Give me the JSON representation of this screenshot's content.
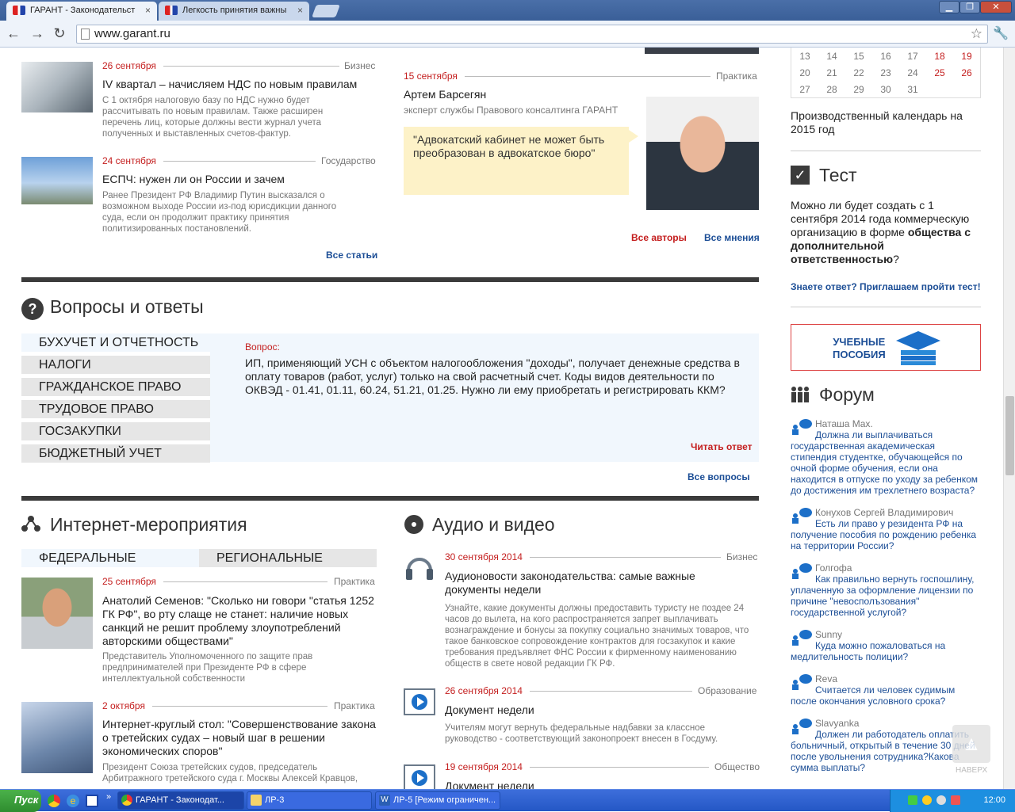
{
  "browser": {
    "tabs": [
      {
        "label": "ГАРАНТ - Законодательст",
        "close": "×"
      },
      {
        "label": "Легкость принятия важны",
        "close": "×"
      }
    ],
    "url": "www.garant.ru",
    "window_controls": [
      "▁",
      "❐",
      "✕"
    ]
  },
  "articles": [
    {
      "date": "26 сентября",
      "category": "Бизнес",
      "title": "IV квартал – начисляем НДС по новым правилам",
      "desc": "С 1 октября налоговую базу по НДС нужно будет рассчитывать по новым правилам. Также расширен перечень лиц, которые должны вести журнал учета полученных и выставленных счетов-фактур."
    },
    {
      "date": "24 сентября",
      "category": "Государство",
      "title": "ЕСПЧ: нужен ли он России и зачем",
      "desc": "Ранее Президент РФ Владимир Путин высказался о возможном выходе России из-под юрисдикции данного суда, если он продолжит практику принятия политизированных постановлений."
    }
  ],
  "all_articles": "Все статьи",
  "opinion": {
    "date": "15 сентября",
    "category": "Практика",
    "author": "Артем Барсегян",
    "role": "эксперт службы Правового консалтинга ГАРАНТ",
    "quote": "\"Адвокатский кабинет не может быть преобразован в адвокатское бюро\"",
    "all_authors": "Все авторы",
    "all_opinions": "Все мнения"
  },
  "qa": {
    "title": "Вопросы и ответы",
    "categories": [
      "БУХУЧЕТ И ОТЧЕТНОСТЬ",
      "НАЛОГИ",
      "ГРАЖДАНСКОЕ ПРАВО",
      "ТРУДОВОЕ ПРАВО",
      "ГОСЗАКУПКИ",
      "БЮДЖЕТНЫЙ УЧЕТ"
    ],
    "question_label": "Вопрос:",
    "question": "ИП, применяющий УСН с объектом налогообложения \"доходы\", получает денежные средства в оплату товаров (работ, услуг) только на свой расчетный счет. Коды видов деятельности по ОКВЭД - 01.41, 01.11, 60.24, 51.21, 01.25. Нужно ли ему приобретать и регистрировать ККМ?",
    "read_answer": "Читать ответ",
    "all_questions": "Все вопросы"
  },
  "events": {
    "title": "Интернет-мероприятия",
    "tabs": [
      "ФЕДЕРАЛЬНЫЕ",
      "РЕГИОНАЛЬНЫЕ"
    ],
    "items": [
      {
        "date": "25 сентября",
        "category": "Практика",
        "title": "Анатолий Семенов: \"Сколько ни говори \"статья 1252 ГК РФ\", во рту слаще не станет: наличие новых санкций не решит проблему злоупотреблений авторскими обществами\"",
        "desc": "Представитель Уполномоченного по защите прав предпринимателей при Президенте РФ в сфере интеллектуальной собственности"
      },
      {
        "date": "2 октября",
        "category": "Практика",
        "title": "Интернет-круглый стол: \"Совершенствование закона о третейских судах – новый шаг в решении экономических споров\"",
        "desc": "Президент Союза третейских судов, председатель Арбитражного третейского суда г. Москвы Алексей Кравцов,"
      }
    ]
  },
  "media": {
    "title": "Аудио и видео",
    "items": [
      {
        "date": "30 сентября 2014",
        "category": "Бизнес",
        "title": "Аудионовости законодательства: самые важные документы недели",
        "desc": "Узнайте, какие документы должны предоставить туристу не поздее 24 часов до вылета, на кого распространяется запрет выплачивать вознаграждение и бонусы за покупку социально значимых товаров, что такое банковское сопровождение контрактов для госзакупок и какие требования предъявляет ФНС России к фирменному наименованию обществ в свете новой редакции ГК РФ."
      },
      {
        "date": "26 сентября 2014",
        "category": "Образование",
        "title": "Документ недели",
        "desc": "Учителям могут вернуть федеральные надбавки за классное руководство - соответствующий законопроект внесен в Госдуму."
      },
      {
        "date": "19 сентября 2014",
        "category": "Общество",
        "title": "Документ недели",
        "desc": ""
      }
    ]
  },
  "calendar": {
    "rows": [
      [
        "13",
        "14",
        "15",
        "16",
        "17",
        "18",
        "19"
      ],
      [
        "20",
        "21",
        "22",
        "23",
        "24",
        "25",
        "26"
      ],
      [
        "27",
        "28",
        "29",
        "30",
        "31",
        "",
        ""
      ]
    ],
    "caption": "Производственный календарь на 2015 год"
  },
  "test": {
    "title": "Тест",
    "text_before": "Можно ли будет создать с 1 сентября 2014 года коммерческую организацию в форме ",
    "text_bold": "общества с дополнительной ответственностью",
    "text_after": "?",
    "link": "Знаете ответ? Приглашаем пройти тест!"
  },
  "banner": {
    "line1": "УЧЕБНЫЕ",
    "line2": "ПОСОБИЯ"
  },
  "forum": {
    "title": "Форум",
    "items": [
      {
        "author": "Наташа Max.",
        "question": "Должна ли выплачиваться государственная академическая стипендия студентке, обучающейся по очной форме обучения, если она находится в отпуске по уходу за ребенком до достижения им трехлетнего возраста?"
      },
      {
        "author": "Конухов Сергей Владимирович",
        "question": "Есть ли право у резидента РФ на получение пособия по рождению ребенка на территории России?"
      },
      {
        "author": "Голгофа",
        "question": "Как правильно вернуть госпошлину, уплаченную за оформление лицензии по причине \"невосполъзования\" государственной услугой?"
      },
      {
        "author": "Sunny",
        "question": "Куда можно пожаловаться на медлительность полиции?"
      },
      {
        "author": "Reva",
        "question": "Считается ли человек судимым после окончания условного срока?"
      },
      {
        "author": "Slavyanka",
        "question": "Должен ли работодатель оплатить больничный, открытый в течение 30 дней после увольнения сотрудника?Какова сумма выплаты?"
      }
    ]
  },
  "to_top": "НАВЕРХ",
  "taskbar": {
    "start": "Пуск",
    "buttons": [
      "ГАРАНТ - Законодат...",
      "ЛР-3",
      "ЛР-5 [Режим ограничен..."
    ],
    "lang": "EN",
    "clock": "12:00"
  },
  "colors": {
    "accent_red": "#c41e1e",
    "link_blue": "#1c4e96",
    "dark_bar": "#3b3b3b"
  }
}
